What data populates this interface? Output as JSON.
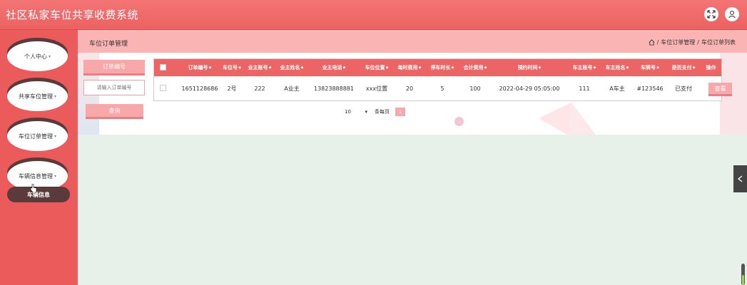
{
  "app": {
    "title": "社区私家车位共享收费系统"
  },
  "header": {
    "icons": [
      "fullscreen-icon",
      "user-icon"
    ]
  },
  "sidebar": {
    "items": [
      {
        "label": "个人中心"
      },
      {
        "label": "共享车位管理"
      },
      {
        "label": "车位订单管理"
      },
      {
        "label": "车辆信息管理"
      }
    ],
    "submenu": {
      "label": "车辆信息"
    }
  },
  "page": {
    "title": "车位订单管理",
    "breadcrumb": [
      "车位订单管理",
      "车位订单列表"
    ]
  },
  "search": {
    "label": "订单编号",
    "placeholder": "请输入订单编号",
    "button": "查询"
  },
  "table": {
    "headers": [
      "订单编号",
      "车位号",
      "业主账号",
      "业主姓名",
      "业主电话",
      "车位位置",
      "每时费用",
      "停车时长",
      "合计费用",
      "预约时间",
      "车主账号",
      "车主姓名",
      "车牌号",
      "是否支付",
      "操作"
    ],
    "rows": [
      {
        "cells": [
          "1651128686",
          "2号",
          "222",
          "A业主",
          "13823888881",
          "xxx位置",
          "20",
          "5",
          "100",
          "2022-04-29 05:05:00",
          "111",
          "A车主",
          "#123546",
          "已支付"
        ],
        "action": "查看"
      }
    ]
  },
  "pagination": {
    "page_size": "10",
    "per_page_label": "条每页",
    "current_page": "1"
  },
  "colors": {
    "header": "#ec6262",
    "sidebar": "#ec5b5b",
    "accent_pink": "#f8a8a8",
    "table_header": "#ec6464"
  }
}
